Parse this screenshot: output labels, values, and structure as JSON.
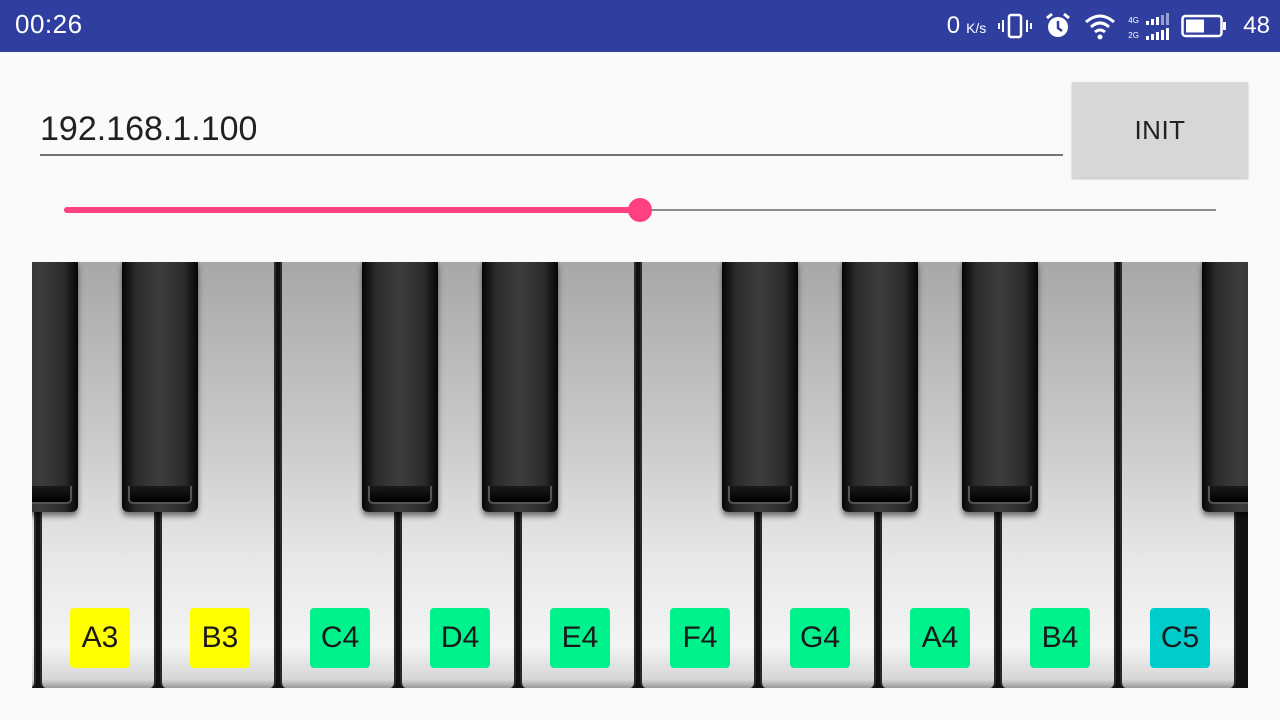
{
  "status_bar": {
    "time": "00:26",
    "net_speed_value": "0",
    "net_speed_unit": "K/s",
    "signal_labels": [
      "4G",
      "2G"
    ],
    "battery_level": "48"
  },
  "ip_field": {
    "value": "192.168.1.100"
  },
  "init_button": {
    "label": "INIT"
  },
  "volume_slider": {
    "value_fraction": 0.5,
    "colors": {
      "active": "#ff4081",
      "inactive": "#8a8a8a"
    }
  },
  "piano": {
    "keys": [
      {
        "label": "A3",
        "color": "#ffff00"
      },
      {
        "label": "B3",
        "color": "#ffff00"
      },
      {
        "label": "C4",
        "color": "#00f28d"
      },
      {
        "label": "D4",
        "color": "#00f28d"
      },
      {
        "label": "E4",
        "color": "#00f28d"
      },
      {
        "label": "F4",
        "color": "#00f28d"
      },
      {
        "label": "G4",
        "color": "#00f28d"
      },
      {
        "label": "A4",
        "color": "#00f28d"
      },
      {
        "label": "B4",
        "color": "#00f28d"
      },
      {
        "label": "C5",
        "color": "#00cccc"
      }
    ]
  },
  "colors": {
    "status_bar_bg": "#303f9f",
    "accent": "#ff4081"
  }
}
